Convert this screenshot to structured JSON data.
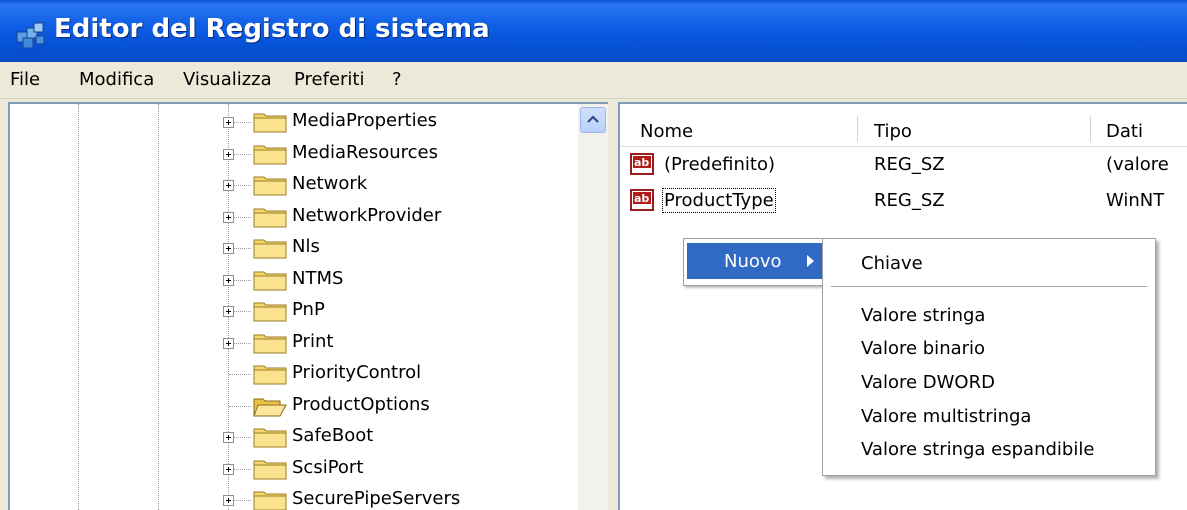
{
  "window": {
    "title": "Editor del Registro di sistema"
  },
  "menubar": {
    "items": [
      "File",
      "Modifica",
      "Visualizza",
      "Preferiti",
      "?"
    ]
  },
  "tree": {
    "items": [
      {
        "label": "MediaProperties",
        "expandable": true
      },
      {
        "label": "MediaResources",
        "expandable": true
      },
      {
        "label": "Network",
        "expandable": true
      },
      {
        "label": "NetworkProvider",
        "expandable": true
      },
      {
        "label": "Nls",
        "expandable": true
      },
      {
        "label": "NTMS",
        "expandable": true
      },
      {
        "label": "PnP",
        "expandable": true
      },
      {
        "label": "Print",
        "expandable": true
      },
      {
        "label": "PriorityControl",
        "expandable": false
      },
      {
        "label": "ProductOptions",
        "expandable": false,
        "open": true
      },
      {
        "label": "SafeBoot",
        "expandable": true
      },
      {
        "label": "ScsiPort",
        "expandable": true
      },
      {
        "label": "SecurePipeServers",
        "expandable": true
      }
    ]
  },
  "list": {
    "columns": [
      "Nome",
      "Tipo",
      "Dati"
    ],
    "rows": [
      {
        "name": "(Predefinito)",
        "type": "REG_SZ",
        "data": "(valore"
      },
      {
        "name": "ProductType",
        "type": "REG_SZ",
        "data": "WinNT"
      }
    ]
  },
  "context_menu": {
    "item": "Nuovo",
    "submenu": {
      "key": "Chiave",
      "values": [
        "Valore stringa",
        "Valore binario",
        "Valore DWORD",
        "Valore multistringa",
        "Valore stringa espandibile"
      ]
    }
  },
  "colors": {
    "titlebar": "#0a56d8",
    "selection": "#316ac5",
    "folder": "#f5d76e"
  },
  "icons": {
    "title": "registry-editor-icon",
    "folder": "folder-icon",
    "value": "string-value-icon"
  }
}
